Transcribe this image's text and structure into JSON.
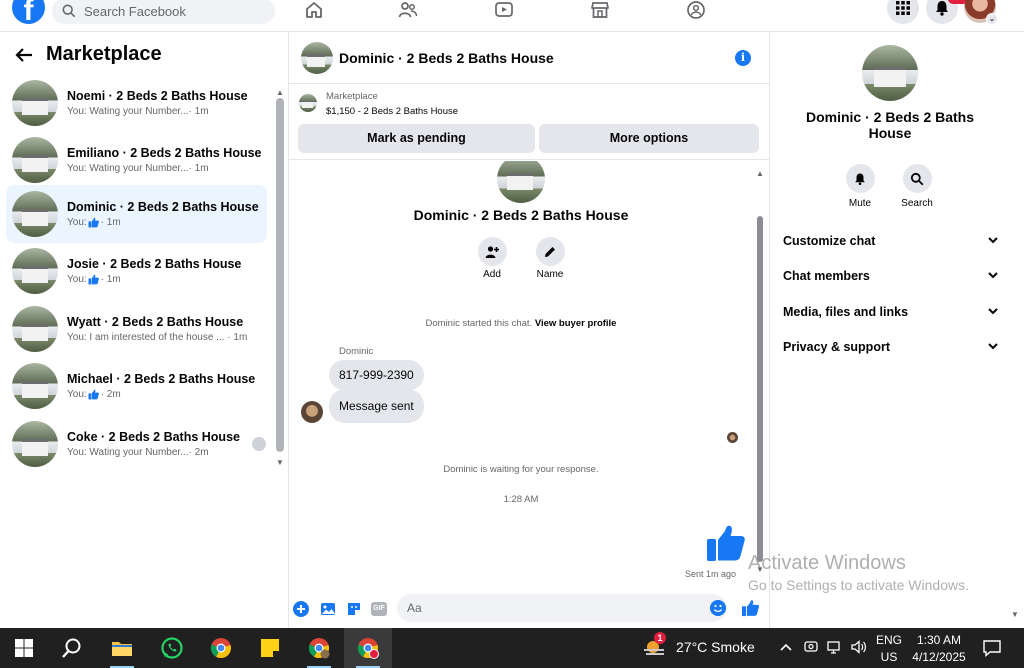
{
  "topbar": {
    "search_placeholder": "Search Facebook",
    "logo_letter": "f"
  },
  "left": {
    "title": "Marketplace",
    "conversations": [
      {
        "title": "Noemi · 2 Beds 2 Baths House",
        "prefix": "You:",
        "preview": " Wating your Number...",
        "time": "· 1m",
        "like": false
      },
      {
        "title": "Emiliano · 2 Beds 2 Baths House",
        "prefix": "You:",
        "preview": " Wating your Number...",
        "time": "· 1m",
        "like": false
      },
      {
        "title": "Dominic · 2 Beds 2 Baths House",
        "prefix": "You:",
        "preview": "",
        "time": "· 1m",
        "like": true
      },
      {
        "title": "Josie · 2 Beds 2 Baths House",
        "prefix": "You:",
        "preview": "",
        "time": "· 1m",
        "like": true
      },
      {
        "title": "Wyatt · 2 Beds 2 Baths House",
        "prefix": "You:",
        "preview": " I am interested of the house ...",
        "time": " · 1m",
        "like": false
      },
      {
        "title": "Michael · 2 Beds 2 Baths House",
        "prefix": "You:",
        "preview": "",
        "time": "· 2m",
        "like": true
      },
      {
        "title": "Coke · 2 Beds 2 Baths House",
        "prefix": "You:",
        "preview": " Wating your Number...",
        "time": "· 2m",
        "like": false
      }
    ]
  },
  "chat": {
    "header_title": "Dominic · 2 Beds 2 Baths House",
    "info_icon": "i",
    "listing_category": "Marketplace",
    "listing_price": "$1,150 - 2 Beds 2 Baths House",
    "mark_pending": "Mark as pending",
    "more_options": "More options",
    "title": "Dominic · 2 Beds 2 Baths House",
    "add_label": "Add",
    "name_label": "Name",
    "started_text": "Dominic started this chat.",
    "view_profile": "View buyer profile",
    "sender_name": "Dominic",
    "messages": [
      "817-999-2390",
      "Message sent"
    ],
    "waiting_text": "Dominic is waiting for your response.",
    "time_stamp": "1:28 AM",
    "sent_text": "Sent 1m ago",
    "composer_placeholder": "Aa",
    "gif_label": "GIF"
  },
  "right": {
    "title": "Dominic · 2 Beds 2 Baths House",
    "mute_label": "Mute",
    "search_label": "Search",
    "rows": [
      "Customize chat",
      "Chat members",
      "Media, files and links",
      "Privacy & support"
    ]
  },
  "watermark": {
    "line1": "Activate Windows",
    "line2": "Go to Settings to activate Windows."
  },
  "taskbar": {
    "weather_badge": "1",
    "weather_text": "27°C  Smoke",
    "lang_top": "ENG",
    "lang_bottom": "US",
    "time": "1:30 AM",
    "date": "4/12/2025"
  },
  "colors": {
    "accent": "#1877f2",
    "active_row": "#ebf5ff",
    "taskbar": "#202020"
  }
}
